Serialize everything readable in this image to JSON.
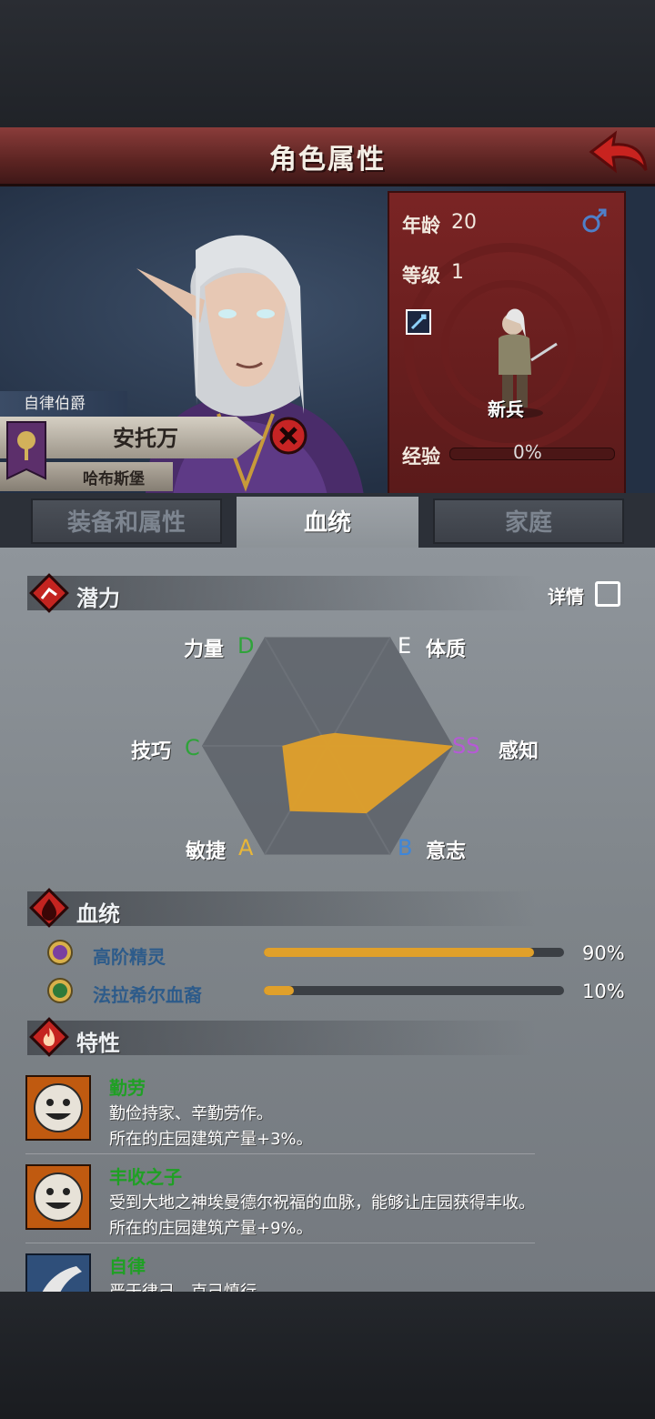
{
  "header": {
    "title": "角色属性"
  },
  "character": {
    "rank": "自律伯爵",
    "name": "安托万",
    "castle": "哈布斯堡"
  },
  "stats_card": {
    "age_label": "年龄",
    "age": "20",
    "level_label": "等级",
    "level": "1",
    "class_name": "新兵",
    "exp_label": "经验",
    "exp_pct": "0%"
  },
  "tabs": [
    {
      "label": "装备和属性"
    },
    {
      "label": "血统"
    },
    {
      "label": "家庭"
    }
  ],
  "potential": {
    "title": "潜力",
    "detail_label": "详情",
    "attributes": [
      {
        "name": "力量",
        "grade": "D",
        "color": "#2fa33a"
      },
      {
        "name": "体质",
        "grade": "E",
        "color": "#ffffff"
      },
      {
        "name": "感知",
        "grade": "SS",
        "color": "#b65ad6"
      },
      {
        "name": "意志",
        "grade": "B",
        "color": "#3f86d8"
      },
      {
        "name": "敏捷",
        "grade": "A",
        "color": "#e8b638"
      },
      {
        "name": "技巧",
        "grade": "C",
        "color": "#2fa33a"
      }
    ],
    "radar_levels": [
      0.1,
      0.12,
      1.0,
      0.62,
      0.6,
      0.36
    ],
    "fill_color": "#e0a02a"
  },
  "bloodline": {
    "title": "血统",
    "lines": [
      {
        "name": "高阶精灵",
        "pct": "90%",
        "value": 0.9
      },
      {
        "name": "法拉希尔血裔",
        "pct": "10%",
        "value": 0.1
      }
    ]
  },
  "traits": {
    "title": "特性",
    "items": [
      {
        "name": "勤劳",
        "desc1": "勤俭持家、辛勤劳作。",
        "desc2": "所在的庄园建筑产量+3%。"
      },
      {
        "name": "丰收之子",
        "desc1": "受到大地之神埃曼德尔祝福的血脉，能够让庄园获得丰收。",
        "desc2": "所在的庄园建筑产量+9%。"
      },
      {
        "name": "自律",
        "desc1": "严于律己、克己慎行"
      }
    ]
  }
}
